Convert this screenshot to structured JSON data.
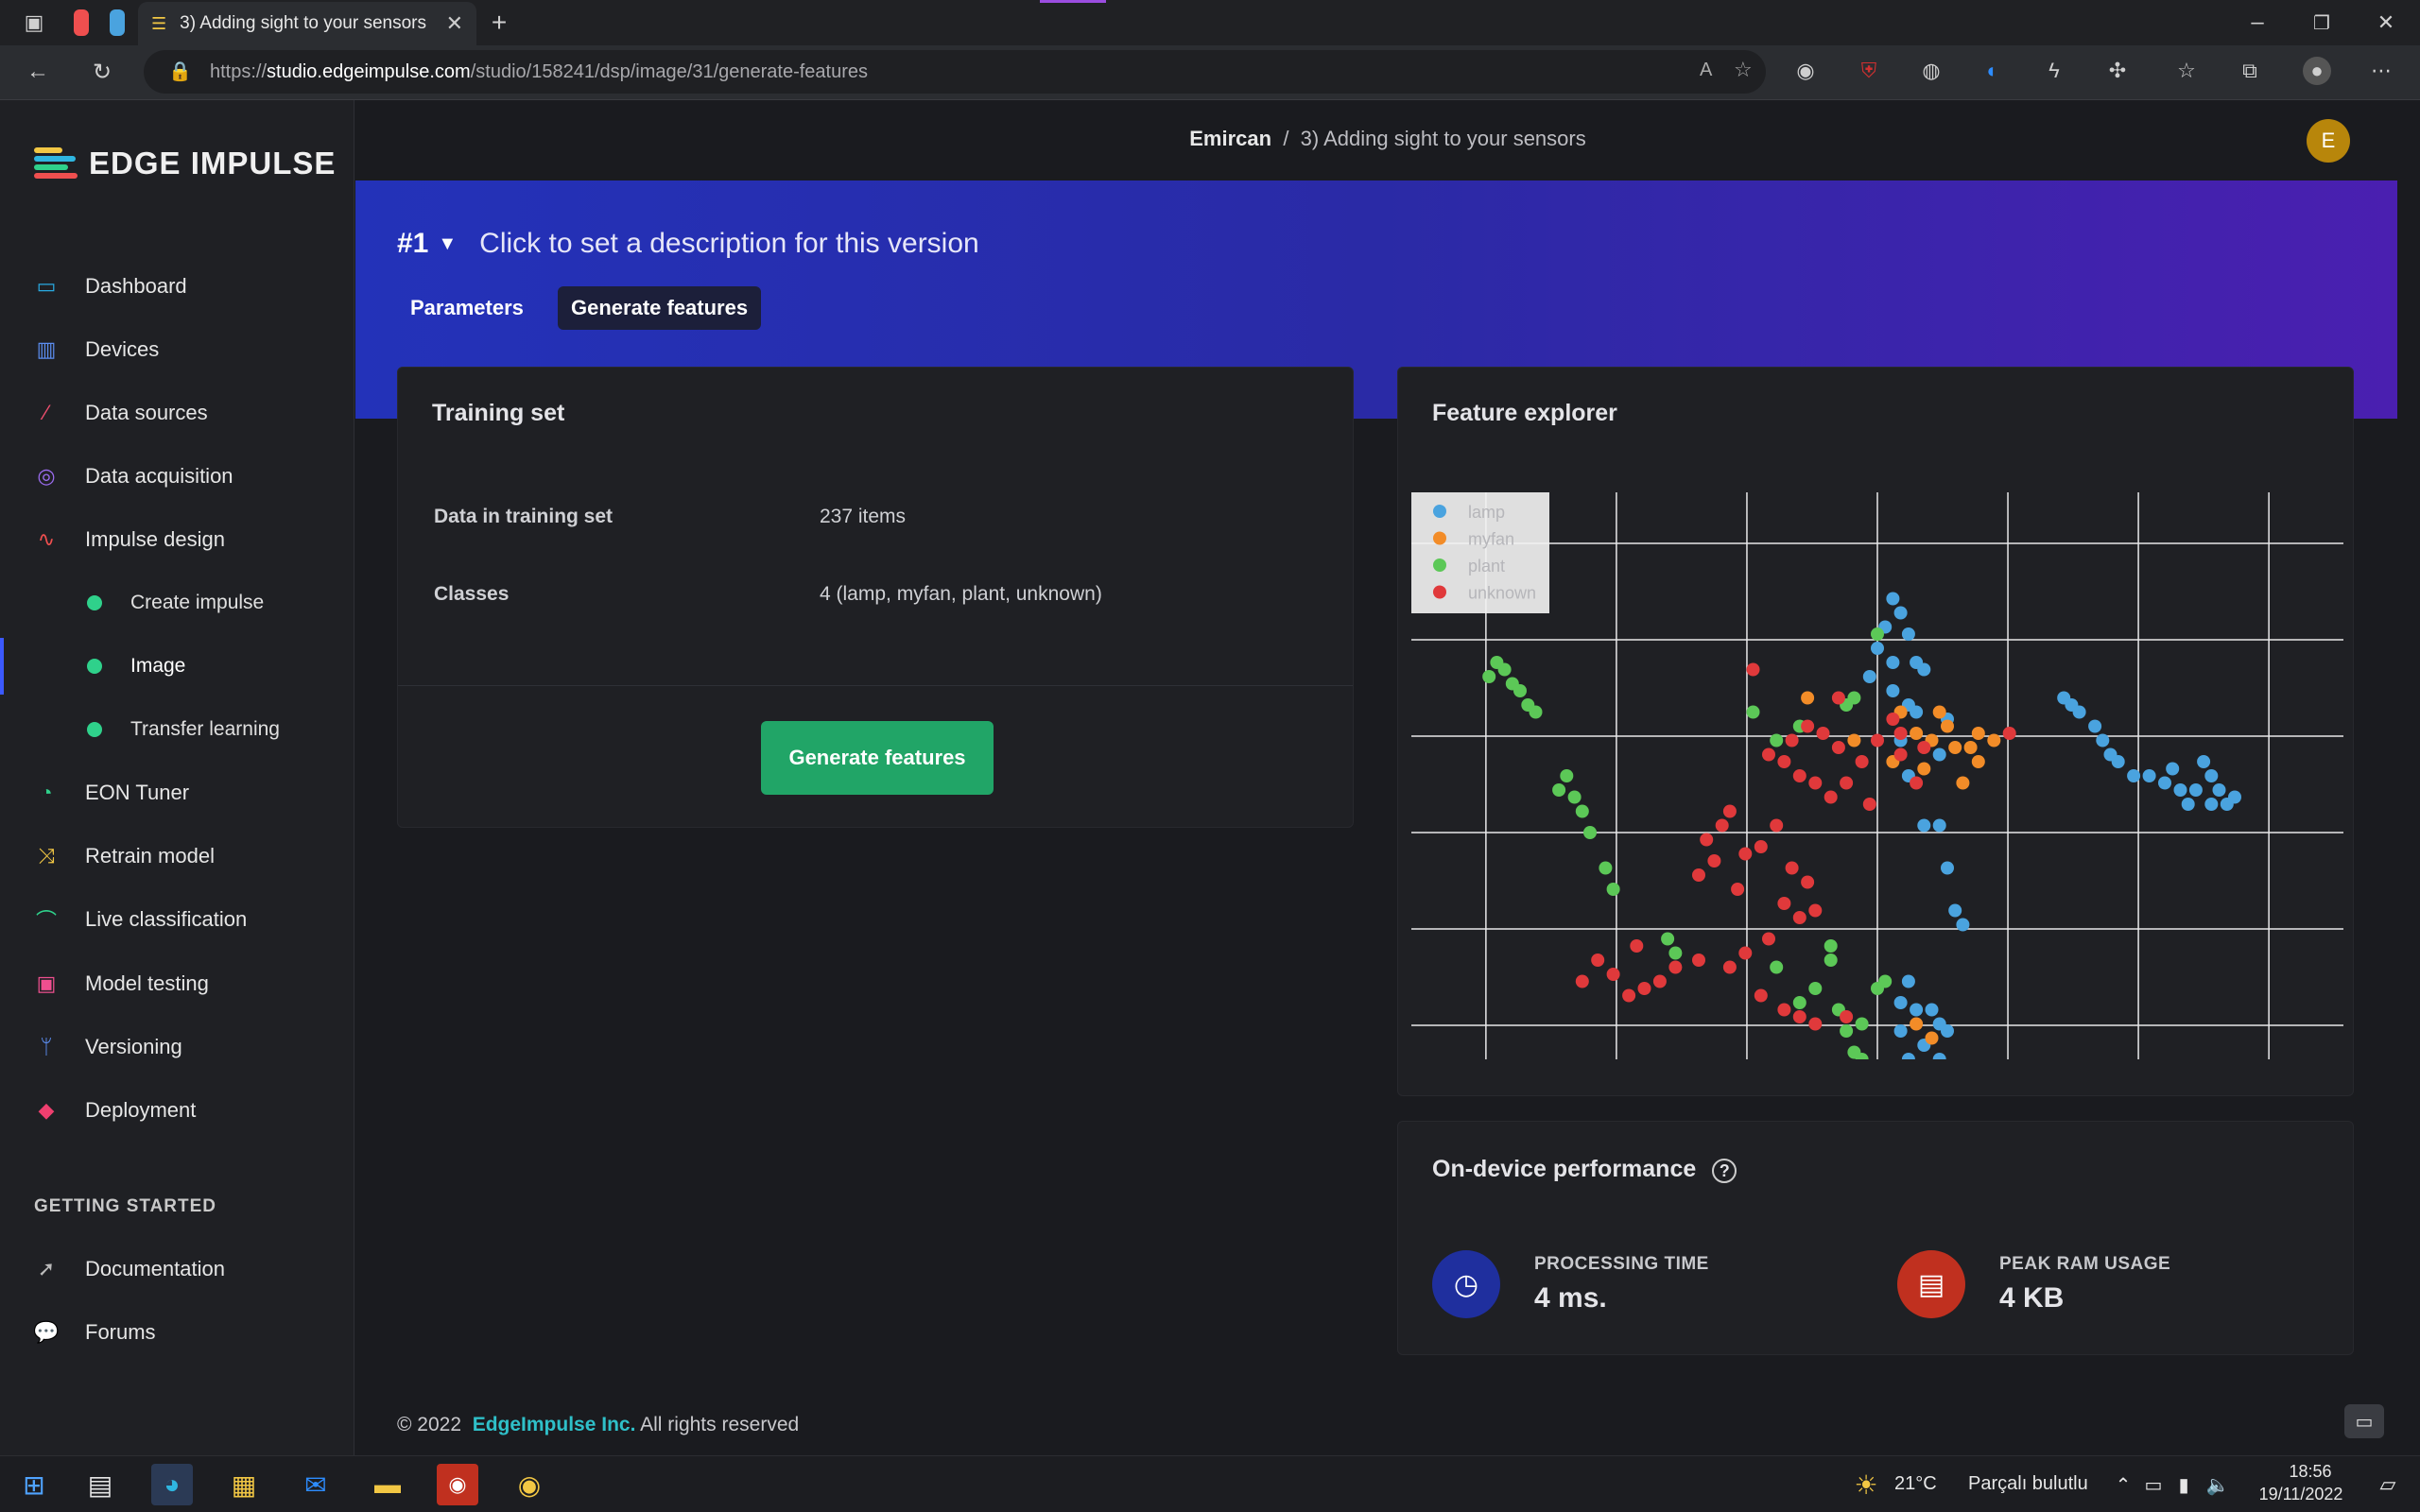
{
  "browser": {
    "tab_title": "3) Adding sight to your sensors",
    "url_scheme": "https://",
    "url_host": "studio.edgeimpulse.com",
    "url_path": "/studio/158241/dsp/image/31/generate-features"
  },
  "app": {
    "logo_text": "EDGE IMPULSE",
    "breadcrumb_user": "Emircan",
    "breadcrumb_sep": "/",
    "breadcrumb_project": "3) Adding sight to your sensors",
    "avatar_letter": "E"
  },
  "sidebar": {
    "items": [
      {
        "label": "Dashboard",
        "icon": "monitor-icon",
        "color": "#29a9e0"
      },
      {
        "label": "Devices",
        "icon": "chip-icon",
        "color": "#5b8def"
      },
      {
        "label": "Data sources",
        "icon": "wand-icon",
        "color": "#ef4f6f"
      },
      {
        "label": "Data acquisition",
        "icon": "database-icon",
        "color": "#9b6cf0"
      },
      {
        "label": "Impulse design",
        "icon": "pulse-icon",
        "color": "#ef4f4f"
      }
    ],
    "sub_items": [
      {
        "label": "Create impulse"
      },
      {
        "label": "Image"
      },
      {
        "label": "Transfer learning"
      }
    ],
    "items2": [
      {
        "label": "EON Tuner",
        "icon": "compass-icon",
        "color": "#2fd18b"
      },
      {
        "label": "Retrain model",
        "icon": "shuffle-icon",
        "color": "#f2c744"
      },
      {
        "label": "Live classification",
        "icon": "signal-icon",
        "color": "#2fd18b"
      },
      {
        "label": "Model testing",
        "icon": "clipboard-check-icon",
        "color": "#ef4f8f"
      },
      {
        "label": "Versioning",
        "icon": "branch-icon",
        "color": "#5b8def"
      },
      {
        "label": "Deployment",
        "icon": "cube-icon",
        "color": "#ef3f6f"
      }
    ],
    "section_title": "GETTING STARTED",
    "getting_started": [
      {
        "label": "Documentation",
        "icon": "rocket-icon"
      },
      {
        "label": "Forums",
        "icon": "chat-bubbles-icon"
      }
    ]
  },
  "banner": {
    "version": "#1",
    "description": "Click to set a description for this version",
    "tabs": [
      "Parameters",
      "Generate features"
    ]
  },
  "training_set": {
    "title": "Training set",
    "rows": [
      {
        "label": "Data in training set",
        "value": "237 items"
      },
      {
        "label": "Classes",
        "value": "4 (lamp, myfan, plant, unknown)"
      }
    ],
    "button": "Generate features"
  },
  "feature_explorer": {
    "title": "Feature explorer"
  },
  "chart_data": {
    "type": "scatter",
    "title": "",
    "xlim": [
      -6,
      6
    ],
    "ylim": [
      -4,
      4
    ],
    "grid": true,
    "legend_position": "top-left",
    "series": [
      {
        "name": "lamp",
        "color": "#4aa3df",
        "points": [
          [
            0.2,
            2.5
          ],
          [
            0.3,
            2.3
          ],
          [
            0.1,
            2.1
          ],
          [
            0.4,
            2.0
          ],
          [
            0.0,
            1.8
          ],
          [
            0.5,
            1.6
          ],
          [
            0.6,
            1.5
          ],
          [
            0.2,
            1.6
          ],
          [
            -0.1,
            1.4
          ],
          [
            0.2,
            1.2
          ],
          [
            0.4,
            1.0
          ],
          [
            0.3,
            0.5
          ],
          [
            0.5,
            0.9
          ],
          [
            0.9,
            0.8
          ],
          [
            0.8,
            0.3
          ],
          [
            0.4,
            0.0
          ],
          [
            0.6,
            -0.7
          ],
          [
            0.8,
            -0.7
          ],
          [
            0.9,
            -1.3
          ],
          [
            1.0,
            -1.9
          ],
          [
            1.1,
            -2.1
          ],
          [
            0.4,
            -2.9
          ],
          [
            0.3,
            -3.2
          ],
          [
            0.5,
            -3.3
          ],
          [
            0.7,
            -3.3
          ],
          [
            0.8,
            -3.5
          ],
          [
            0.9,
            -3.6
          ],
          [
            0.6,
            -3.8
          ],
          [
            0.3,
            -3.6
          ],
          [
            0.4,
            -4.0
          ],
          [
            0.6,
            -4.2
          ],
          [
            0.8,
            -4.0
          ],
          [
            0.3,
            -4.5
          ],
          [
            2.4,
            1.1
          ],
          [
            2.5,
            1.0
          ],
          [
            2.6,
            0.9
          ],
          [
            2.8,
            0.7
          ],
          [
            2.9,
            0.5
          ],
          [
            3.0,
            0.3
          ],
          [
            3.1,
            0.2
          ],
          [
            3.3,
            0.0
          ],
          [
            3.5,
            0.0
          ],
          [
            3.7,
            -0.1
          ],
          [
            3.8,
            0.1
          ],
          [
            3.9,
            -0.2
          ],
          [
            4.0,
            -0.4
          ],
          [
            4.1,
            -0.2
          ],
          [
            4.2,
            0.2
          ],
          [
            4.3,
            0.0
          ],
          [
            4.4,
            -0.2
          ],
          [
            4.5,
            -0.4
          ],
          [
            4.6,
            -0.3
          ],
          [
            4.3,
            -0.4
          ]
        ]
      },
      {
        "name": "myfan",
        "color": "#f28c28",
        "points": [
          [
            -0.9,
            1.1
          ],
          [
            0.3,
            0.9
          ],
          [
            0.5,
            0.6
          ],
          [
            0.7,
            0.5
          ],
          [
            0.8,
            0.9
          ],
          [
            0.9,
            0.7
          ],
          [
            1.0,
            0.4
          ],
          [
            1.2,
            0.4
          ],
          [
            1.3,
            0.6
          ],
          [
            1.5,
            0.5
          ],
          [
            1.3,
            0.2
          ],
          [
            1.1,
            -0.1
          ],
          [
            0.6,
            0.1
          ],
          [
            -0.3,
            0.5
          ],
          [
            0.2,
            0.2
          ],
          [
            0.7,
            -3.7
          ],
          [
            0.5,
            -3.5
          ]
        ]
      },
      {
        "name": "plant",
        "color": "#5cc857",
        "points": [
          [
            -5.0,
            1.4
          ],
          [
            -4.9,
            1.6
          ],
          [
            -4.8,
            1.5
          ],
          [
            -4.7,
            1.3
          ],
          [
            -4.6,
            1.2
          ],
          [
            -4.5,
            1.0
          ],
          [
            -4.4,
            0.9
          ],
          [
            -4.1,
            -0.2
          ],
          [
            -4.0,
            0.0
          ],
          [
            -3.9,
            -0.3
          ],
          [
            -3.8,
            -0.5
          ],
          [
            -3.7,
            -0.8
          ],
          [
            -3.5,
            -1.3
          ],
          [
            -3.4,
            -1.6
          ],
          [
            -2.7,
            -2.3
          ],
          [
            -2.6,
            -2.5
          ],
          [
            -1.6,
            0.9
          ],
          [
            -1.3,
            0.5
          ],
          [
            -1.0,
            0.7
          ],
          [
            -0.3,
            1.1
          ],
          [
            0.0,
            2.0
          ],
          [
            -0.4,
            1.0
          ],
          [
            -0.6,
            -2.4
          ],
          [
            -0.8,
            -3.0
          ],
          [
            -0.5,
            -3.3
          ],
          [
            -0.4,
            -3.6
          ],
          [
            -0.3,
            -3.9
          ],
          [
            -0.2,
            -4.0
          ],
          [
            -0.6,
            -2.6
          ],
          [
            -1.0,
            -3.2
          ],
          [
            -1.3,
            -2.7
          ],
          [
            0.0,
            -3.0
          ],
          [
            -0.2,
            -3.5
          ],
          [
            0.1,
            -2.9
          ]
        ]
      },
      {
        "name": "unknown",
        "color": "#e0393b",
        "points": [
          [
            -1.6,
            1.5
          ],
          [
            -0.5,
            1.1
          ],
          [
            -1.1,
            0.5
          ],
          [
            -0.9,
            0.7
          ],
          [
            -0.7,
            0.6
          ],
          [
            -0.5,
            0.4
          ],
          [
            -1.4,
            0.3
          ],
          [
            -1.2,
            0.2
          ],
          [
            -1.0,
            0.0
          ],
          [
            -0.8,
            -0.1
          ],
          [
            -0.6,
            -0.3
          ],
          [
            -0.4,
            -0.1
          ],
          [
            -0.2,
            0.2
          ],
          [
            0.0,
            0.5
          ],
          [
            0.2,
            0.8
          ],
          [
            0.3,
            0.6
          ],
          [
            -0.1,
            -0.4
          ],
          [
            -1.9,
            -0.5
          ],
          [
            -2.0,
            -0.7
          ],
          [
            -2.2,
            -0.9
          ],
          [
            -2.1,
            -1.2
          ],
          [
            -2.3,
            -1.4
          ],
          [
            -1.8,
            -1.6
          ],
          [
            -1.7,
            -1.1
          ],
          [
            -1.5,
            -1.0
          ],
          [
            -1.3,
            -0.7
          ],
          [
            -1.1,
            -1.3
          ],
          [
            -0.9,
            -1.5
          ],
          [
            -1.2,
            -1.8
          ],
          [
            -1.0,
            -2.0
          ],
          [
            -0.8,
            -1.9
          ],
          [
            -1.4,
            -2.3
          ],
          [
            -1.7,
            -2.5
          ],
          [
            -1.9,
            -2.7
          ],
          [
            -2.3,
            -2.6
          ],
          [
            -2.6,
            -2.7
          ],
          [
            -2.8,
            -2.9
          ],
          [
            -3.0,
            -3.0
          ],
          [
            -3.2,
            -3.1
          ],
          [
            -3.4,
            -2.8
          ],
          [
            -3.6,
            -2.6
          ],
          [
            -3.8,
            -2.9
          ],
          [
            -3.1,
            -2.4
          ],
          [
            -1.5,
            -3.1
          ],
          [
            -1.2,
            -3.3
          ],
          [
            -1.0,
            -3.4
          ],
          [
            -0.8,
            -3.5
          ],
          [
            -0.4,
            -3.4
          ],
          [
            0.3,
            0.3
          ],
          [
            0.6,
            0.4
          ],
          [
            1.7,
            0.6
          ],
          [
            0.5,
            -0.1
          ]
        ]
      }
    ]
  },
  "performance": {
    "title": "On-device performance",
    "metrics": [
      {
        "label": "PROCESSING TIME",
        "value": "4 ms.",
        "icon": "clock-icon",
        "color": "#1f2f9e"
      },
      {
        "label": "PEAK RAM USAGE",
        "value": "4 KB",
        "icon": "memory-icon",
        "color": "#c0301f"
      }
    ]
  },
  "footer": {
    "copyright": "© 2022",
    "company": "EdgeImpulse Inc.",
    "rights": "All rights reserved"
  },
  "taskbar": {
    "weather": "21°C",
    "weather_desc": "Parçalı bulutlu",
    "time": "18:56",
    "date": "19/11/2022"
  }
}
